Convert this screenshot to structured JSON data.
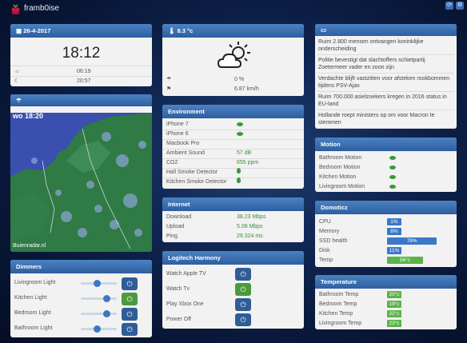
{
  "app": {
    "title": "framb0ise"
  },
  "date_panel": {
    "date": "26-4-2017",
    "time": "18:12",
    "sunrise": "06:19",
    "sunset": "20:57"
  },
  "weather": {
    "temp": "8.3 °c",
    "rain": "0 %",
    "wind": "6.87 km/h"
  },
  "news": {
    "items": [
      "Ruim 2.800 mensen ontvangen koninklijke onderscheiding",
      "Politie bevestigt dat slachtoffers schietpartij Zoetermeer vader en zoon zijn",
      "Verdachte blijft vastzitten voor afsteken rookbommen tijdens PSV-Ajax",
      "Ruim 700.000 asielzoekers kregen in 2016 status in EU-land",
      "Hollande roept ministers op om voor Macron te stemmen"
    ]
  },
  "radar": {
    "label": "wo 18:20",
    "credit": "Buienradar.nl"
  },
  "environment": {
    "title": "Environment",
    "rows": [
      {
        "label": "iPhone 7",
        "value": ""
      },
      {
        "label": "iPhone 6",
        "value": ""
      },
      {
        "label": "Macbook Pro",
        "value": ""
      },
      {
        "label": "Ambient Sound",
        "value": "57 dB"
      },
      {
        "label": "CO2",
        "value": "655 ppm"
      },
      {
        "label": "Hall Smoke Detector",
        "value": ""
      },
      {
        "label": "Kitchen Smoke Detector",
        "value": ""
      }
    ]
  },
  "motion": {
    "title": "Motion",
    "rows": [
      "Bathroom Motion",
      "Bedroom Motion",
      "Kitchen Motion",
      "Livingroom Motion"
    ]
  },
  "internet": {
    "title": "Internet",
    "rows": [
      {
        "label": "Download",
        "value": "38.23 Mbps"
      },
      {
        "label": "Upload",
        "value": "5.08 Mbps"
      },
      {
        "label": "Ping",
        "value": "29.324 ms"
      }
    ]
  },
  "domoticz": {
    "title": "Domoticz",
    "rows": [
      {
        "label": "CPU",
        "value": "1%",
        "level": 1,
        "color": "#3a78c8"
      },
      {
        "label": "Memory",
        "value": "8%",
        "level": 8,
        "color": "#3a78c8"
      },
      {
        "label": "SSD health",
        "value": "78%",
        "level": 78,
        "color": "#3a78c8"
      },
      {
        "label": "Disk",
        "value": "11%",
        "level": 11,
        "color": "#3a78c8"
      },
      {
        "label": "Temp",
        "value": "56°c",
        "level": 56,
        "color": "#5bb34a"
      }
    ]
  },
  "dimmers": {
    "title": "Dimmers",
    "rows": [
      {
        "label": "Livingroom Light",
        "level": 0.45,
        "on": false
      },
      {
        "label": "Kitchen Light",
        "level": 0.7,
        "on": true
      },
      {
        "label": "Bedroom Light",
        "level": 0.72,
        "on": false
      },
      {
        "label": "Bathroom Light",
        "level": 0.45,
        "on": false
      }
    ]
  },
  "harmony": {
    "title": "Logitech Harmony",
    "rows": [
      {
        "label": "Watch Apple TV",
        "on": false
      },
      {
        "label": "Watch Tv",
        "on": true
      },
      {
        "label": "Play Xbox One",
        "on": false
      },
      {
        "label": "Power Off",
        "on": false
      }
    ]
  },
  "temperature": {
    "title": "Temperature",
    "rows": [
      {
        "label": "Bathroom Temp",
        "value": "20°c"
      },
      {
        "label": "Bedroom Temp",
        "value": "19°c"
      },
      {
        "label": "Kitchen Temp",
        "value": "22°c"
      },
      {
        "label": "Livingroom Temp",
        "value": "23°c"
      }
    ],
    "color": "#5bb34a"
  },
  "icons": [
    "raspberry-logo-icon",
    "refresh-icon",
    "settings-icon",
    "calendar-icon",
    "sunrise-icon",
    "moon-icon",
    "thermometer-icon",
    "umbrella-icon",
    "flag-icon",
    "newspaper-icon",
    "radar-icon",
    "power-icon",
    "eye-icon",
    "flame-icon"
  ]
}
